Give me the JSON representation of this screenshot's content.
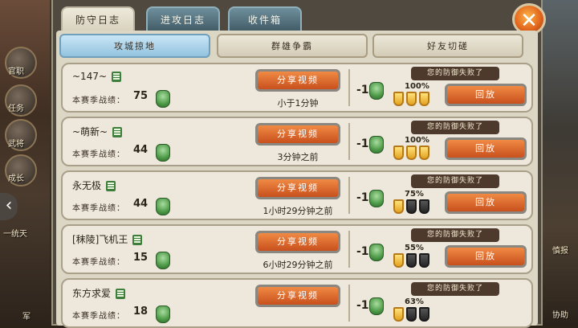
{
  "window": {
    "tabs": [
      {
        "label": "防守日志",
        "active": true
      },
      {
        "label": "进攻日志",
        "active": false
      },
      {
        "label": "收件箱",
        "active": false
      }
    ],
    "close_icon": "close-x-icon"
  },
  "subtabs": [
    {
      "label": "攻城掠地",
      "active": true
    },
    {
      "label": "群雄争霸",
      "active": false
    },
    {
      "label": "好友切磋",
      "active": false
    }
  ],
  "side_labels": {
    "left": [
      "官职",
      "任务",
      "武将",
      "成长",
      "一统天",
      "军"
    ],
    "right": [
      "慎报",
      "协助"
    ]
  },
  "score_label": "本赛季战绩：",
  "share_label": "分享视频",
  "replay_label": "回放",
  "defeat_text": "您的防御失败了",
  "logs": [
    {
      "name": "~147~",
      "score": "75",
      "time": "小于1分钟",
      "change": "-1",
      "percent": "100%",
      "stars": [
        1,
        1,
        1
      ]
    },
    {
      "name": "~萌新~",
      "score": "44",
      "time": "3分钟之前",
      "change": "-1",
      "percent": "100%",
      "stars": [
        1,
        1,
        1
      ]
    },
    {
      "name": "永无极",
      "score": "44",
      "time": "1小时29分钟之前",
      "change": "-1",
      "percent": "75%",
      "stars": [
        1,
        0,
        0
      ]
    },
    {
      "name": "[秣陵]飞机王",
      "score": "15",
      "time": "6小时29分钟之前",
      "change": "-1",
      "percent": "55%",
      "stars": [
        1,
        0,
        0
      ]
    },
    {
      "name": "东方求爱",
      "score": "18",
      "time": "",
      "change": "-1",
      "percent": "63%",
      "stars": [
        1,
        0,
        0
      ]
    }
  ],
  "colors": {
    "accent_orange": "#e0621a",
    "tab_active_bg": "#eeeadb",
    "subtab_active_bg": "#93c3df",
    "badge_green": "#4f9c49",
    "shield_gold": "#e2a321"
  }
}
